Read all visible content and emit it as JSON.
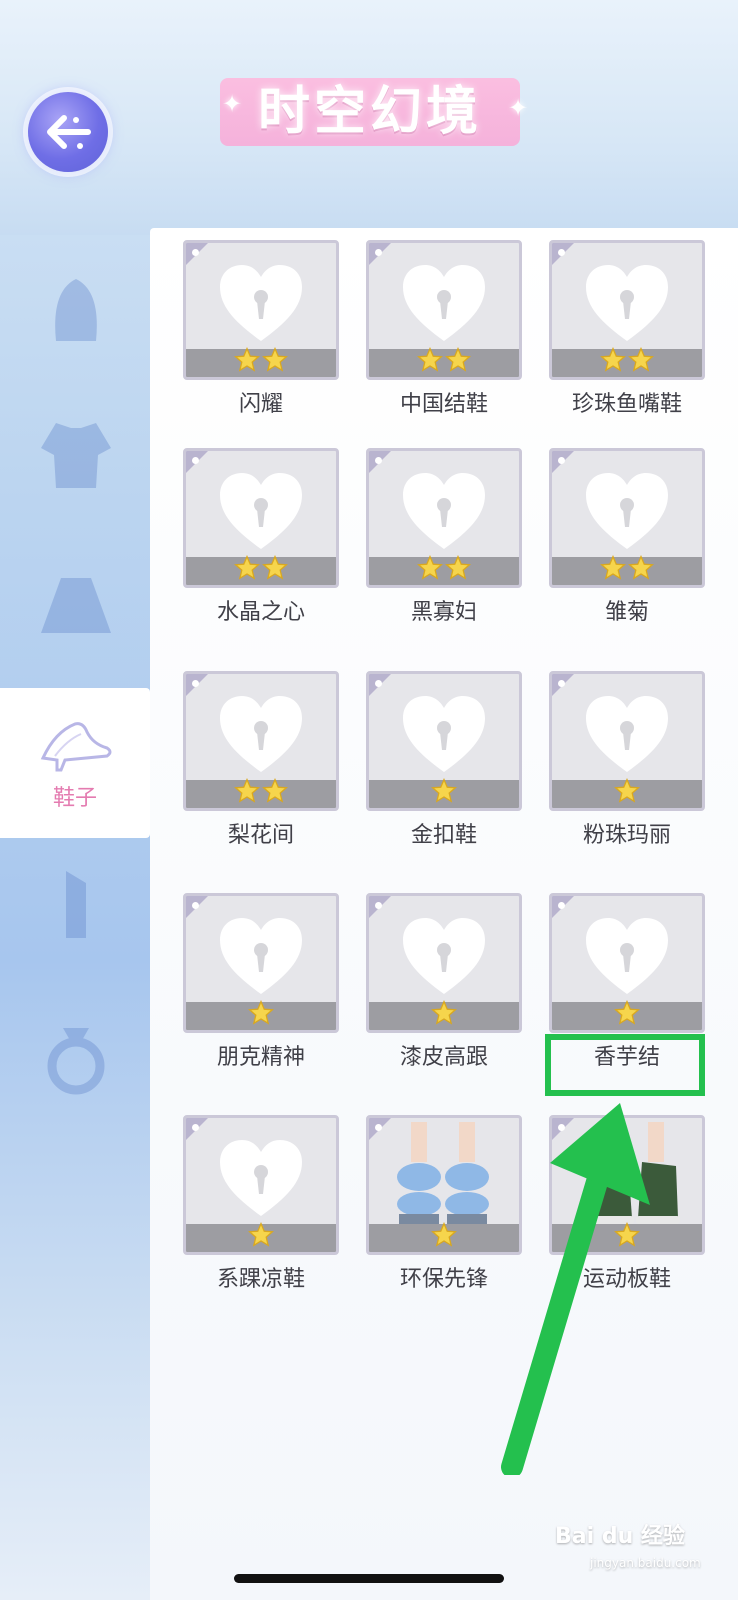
{
  "header": {
    "title": "时空幻境"
  },
  "sidebar": {
    "active_label": "鞋子"
  },
  "items": [
    {
      "name": "闪耀",
      "stars": 2,
      "image": "locked-heart"
    },
    {
      "name": "中国结鞋",
      "stars": 2,
      "image": "locked-heart"
    },
    {
      "name": "珍珠鱼嘴鞋",
      "stars": 2,
      "image": "locked-heart"
    },
    {
      "name": "水晶之心",
      "stars": 2,
      "image": "locked-heart"
    },
    {
      "name": "黑寡妇",
      "stars": 2,
      "image": "locked-heart"
    },
    {
      "name": "雏菊",
      "stars": 2,
      "image": "locked-heart"
    },
    {
      "name": "梨花间",
      "stars": 2,
      "image": "locked-heart"
    },
    {
      "name": "金扣鞋",
      "stars": 1,
      "image": "locked-heart"
    },
    {
      "name": "粉珠玛丽",
      "stars": 1,
      "image": "locked-heart"
    },
    {
      "name": "朋克精神",
      "stars": 1,
      "image": "locked-heart"
    },
    {
      "name": "漆皮高跟",
      "stars": 1,
      "image": "locked-heart"
    },
    {
      "name": "香芋结",
      "stars": 1,
      "image": "locked-heart"
    },
    {
      "name": "系踝凉鞋",
      "stars": 1,
      "image": "locked-heart"
    },
    {
      "name": "环保先锋",
      "stars": 1,
      "image": "blue-slide-sandals"
    },
    {
      "name": "运动板鞋",
      "stars": 1,
      "image": "green-sneakers"
    }
  ],
  "annotation": {
    "highlight_color": "#24c04e",
    "arrow_color": "#24c04e"
  },
  "watermark": {
    "brand": "Bai du 经验",
    "url": "jingyan.baidu.com"
  }
}
